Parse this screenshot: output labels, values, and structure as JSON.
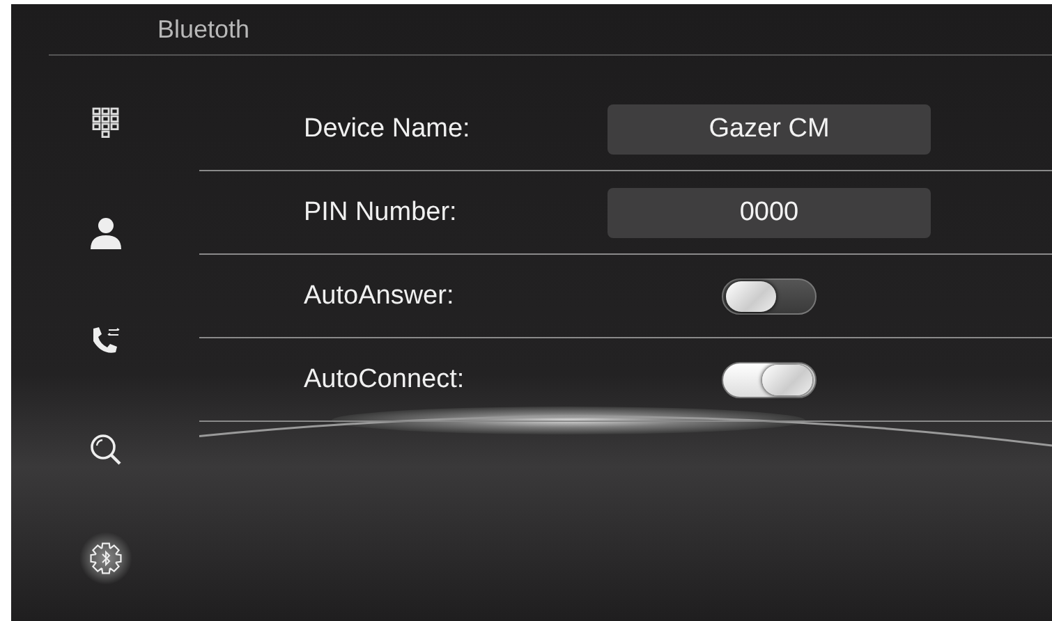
{
  "header": {
    "title": "Bluetoth"
  },
  "sidebar": {
    "items": [
      {
        "kind": "keypad",
        "selected": false
      },
      {
        "kind": "contacts",
        "selected": false
      },
      {
        "kind": "calls",
        "selected": false
      },
      {
        "kind": "search",
        "selected": false
      },
      {
        "kind": "settings",
        "selected": true
      }
    ]
  },
  "settings": [
    {
      "kind": "field",
      "label": "Device Name:",
      "value": "Gazer CM"
    },
    {
      "kind": "field",
      "label": "PIN Number:",
      "value": "0000"
    },
    {
      "kind": "toggle",
      "label": "AutoAnswer:",
      "on": false
    },
    {
      "kind": "toggle",
      "label": "AutoConnect:",
      "on": true
    }
  ]
}
